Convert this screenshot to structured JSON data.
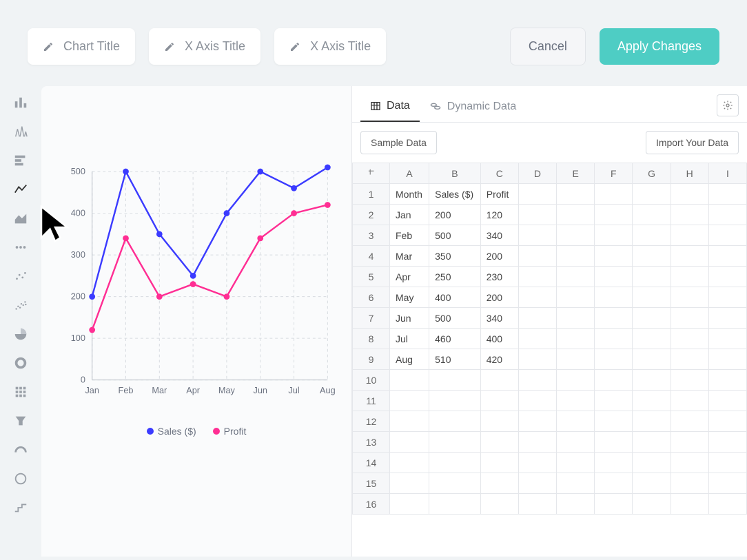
{
  "top": {
    "chart_title_placeholder": "Chart Title",
    "xaxis_title_placeholder_1": "X Axis Title",
    "xaxis_title_placeholder_2": "X Axis Title",
    "cancel": "Cancel",
    "apply": "Apply Changes"
  },
  "sidebar_tools": [
    "bar",
    "histogram",
    "hbar",
    "line",
    "area",
    "dots",
    "scatter3",
    "scatter",
    "pie",
    "donut",
    "matrix",
    "funnel",
    "gauge",
    "circle",
    "steps"
  ],
  "tabs": {
    "data": "Data",
    "dynamic": "Dynamic Data"
  },
  "data_toolbar": {
    "sample": "Sample Data",
    "import": "Import Your Data"
  },
  "columns": [
    "A",
    "B",
    "C",
    "D",
    "E",
    "F",
    "G",
    "H",
    "I"
  ],
  "rows": [
    [
      "Month",
      "Sales ($)",
      "Profit",
      "",
      "",
      "",
      "",
      "",
      ""
    ],
    [
      "Jan",
      "200",
      "120",
      "",
      "",
      "",
      "",
      "",
      ""
    ],
    [
      "Feb",
      "500",
      "340",
      "",
      "",
      "",
      "",
      "",
      ""
    ],
    [
      "Mar",
      "350",
      "200",
      "",
      "",
      "",
      "",
      "",
      ""
    ],
    [
      "Apr",
      "250",
      "230",
      "",
      "",
      "",
      "",
      "",
      ""
    ],
    [
      "May",
      "400",
      "200",
      "",
      "",
      "",
      "",
      "",
      ""
    ],
    [
      "Jun",
      "500",
      "340",
      "",
      "",
      "",
      "",
      "",
      ""
    ],
    [
      "Jul",
      "460",
      "400",
      "",
      "",
      "",
      "",
      "",
      ""
    ],
    [
      "Aug",
      "510",
      "420",
      "",
      "",
      "",
      "",
      "",
      ""
    ],
    [
      "",
      "",
      "",
      "",
      "",
      "",
      "",
      "",
      ""
    ],
    [
      "",
      "",
      "",
      "",
      "",
      "",
      "",
      "",
      ""
    ],
    [
      "",
      "",
      "",
      "",
      "",
      "",
      "",
      "",
      ""
    ],
    [
      "",
      "",
      "",
      "",
      "",
      "",
      "",
      "",
      ""
    ],
    [
      "",
      "",
      "",
      "",
      "",
      "",
      "",
      "",
      ""
    ],
    [
      "",
      "",
      "",
      "",
      "",
      "",
      "",
      "",
      ""
    ],
    [
      "",
      "",
      "",
      "",
      "",
      "",
      "",
      "",
      ""
    ]
  ],
  "legend": {
    "s1": "Sales ($)",
    "s2": "Profit"
  },
  "colors": {
    "sales": "#3b3bff",
    "profit": "#ff2e93",
    "grid": "#d7dbe0",
    "axis_text": "#6b7280"
  },
  "chart_data": {
    "type": "line",
    "categories": [
      "Jan",
      "Feb",
      "Mar",
      "Apr",
      "May",
      "Jun",
      "Jul",
      "Aug"
    ],
    "series": [
      {
        "name": "Sales ($)",
        "values": [
          200,
          500,
          350,
          250,
          400,
          500,
          460,
          510
        ],
        "color": "#3b3bff"
      },
      {
        "name": "Profit",
        "values": [
          120,
          340,
          200,
          230,
          200,
          340,
          400,
          420
        ],
        "color": "#ff2e93"
      }
    ],
    "ylim": [
      0,
      500
    ],
    "yticks": [
      0,
      100,
      200,
      300,
      400,
      500
    ],
    "xlabel": "",
    "ylabel": "",
    "title": ""
  }
}
